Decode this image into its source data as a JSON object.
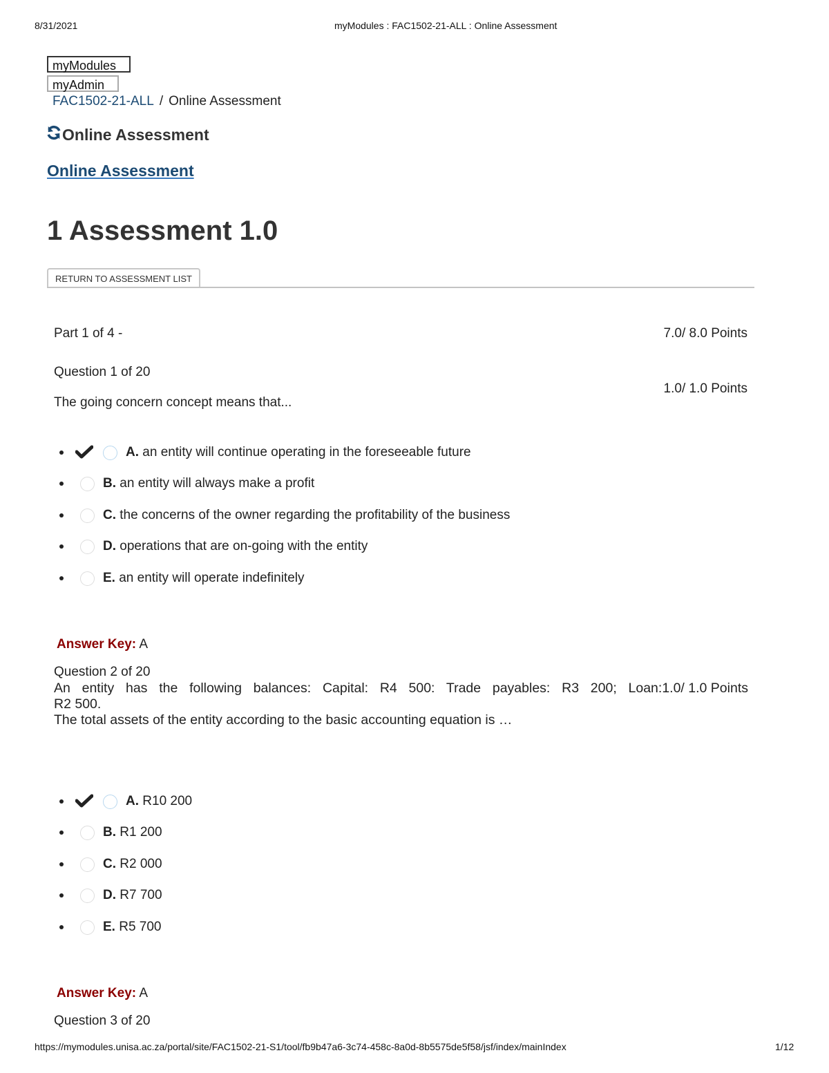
{
  "print_header": {
    "date": "8/31/2021",
    "title": "myModules : FAC1502-21-ALL : Online Assessment"
  },
  "print_footer": {
    "url": "https://mymodules.unisa.ac.za/portal/site/FAC1502-21-S1/tool/fb9b47a6-3c74-458c-8a0d-8b5575de5f58/jsf/index/mainIndex",
    "page": "1/12"
  },
  "nav": {
    "mymodules": "myModules",
    "myadmin": "myAdmin"
  },
  "breadcrumb": {
    "site": "FAC1502-21-ALL",
    "separator": "/",
    "current": "Online Assessment"
  },
  "tool_title": {
    "icon": "refresh-icon",
    "label": "Online Assessment"
  },
  "page_link": "Online Assessment",
  "assessment": {
    "title": "1 Assessment 1.0",
    "return_button": "RETURN TO ASSESSMENT LIST",
    "part_label": "Part 1 of 4 -",
    "part_points": "7.0/ 8.0 Points"
  },
  "colors": {
    "link": "#1b4a73",
    "answer_key": "#8b0000",
    "text": "#333333"
  },
  "questions": [
    {
      "number": "Question 1 of 20",
      "points": "1.0/ 1.0 Points",
      "text": "The going concern concept means that...",
      "options": [
        {
          "letter": "A.",
          "text": "an entity will continue operating in the foreseeable future",
          "marked_correct": true
        },
        {
          "letter": "B.",
          "text": "an entity will always make a profit",
          "marked_correct": false
        },
        {
          "letter": "C.",
          "text": "the concerns of the owner regarding the profitability of the business",
          "marked_correct": false
        },
        {
          "letter": "D.",
          "text": "operations that are on-going with the entity",
          "marked_correct": false
        },
        {
          "letter": "E.",
          "text": "an entity will operate indefinitely",
          "marked_correct": false
        }
      ],
      "answer_key_label": "Answer Key:",
      "answer_key_value": "A"
    },
    {
      "number": "Question 2 of 20",
      "points": "1.0/ 1.0 Points",
      "text_line1": "An entity has the following balances: Capital: R4 500: Trade payables: R3 200; Loan:",
      "text_line2": "R2 500.",
      "text_line3": "The total assets of the entity according to the basic accounting equation is …",
      "options": [
        {
          "letter": "A.",
          "text": "R10 200",
          "marked_correct": true
        },
        {
          "letter": "B.",
          "text": "R1 200",
          "marked_correct": false
        },
        {
          "letter": "C.",
          "text": "R2 000",
          "marked_correct": false
        },
        {
          "letter": "D.",
          "text": "R7 700",
          "marked_correct": false
        },
        {
          "letter": "E.",
          "text": "R5 700",
          "marked_correct": false
        }
      ],
      "answer_key_label": "Answer Key:",
      "answer_key_value": "A"
    },
    {
      "number": "Question 3 of 20"
    }
  ]
}
